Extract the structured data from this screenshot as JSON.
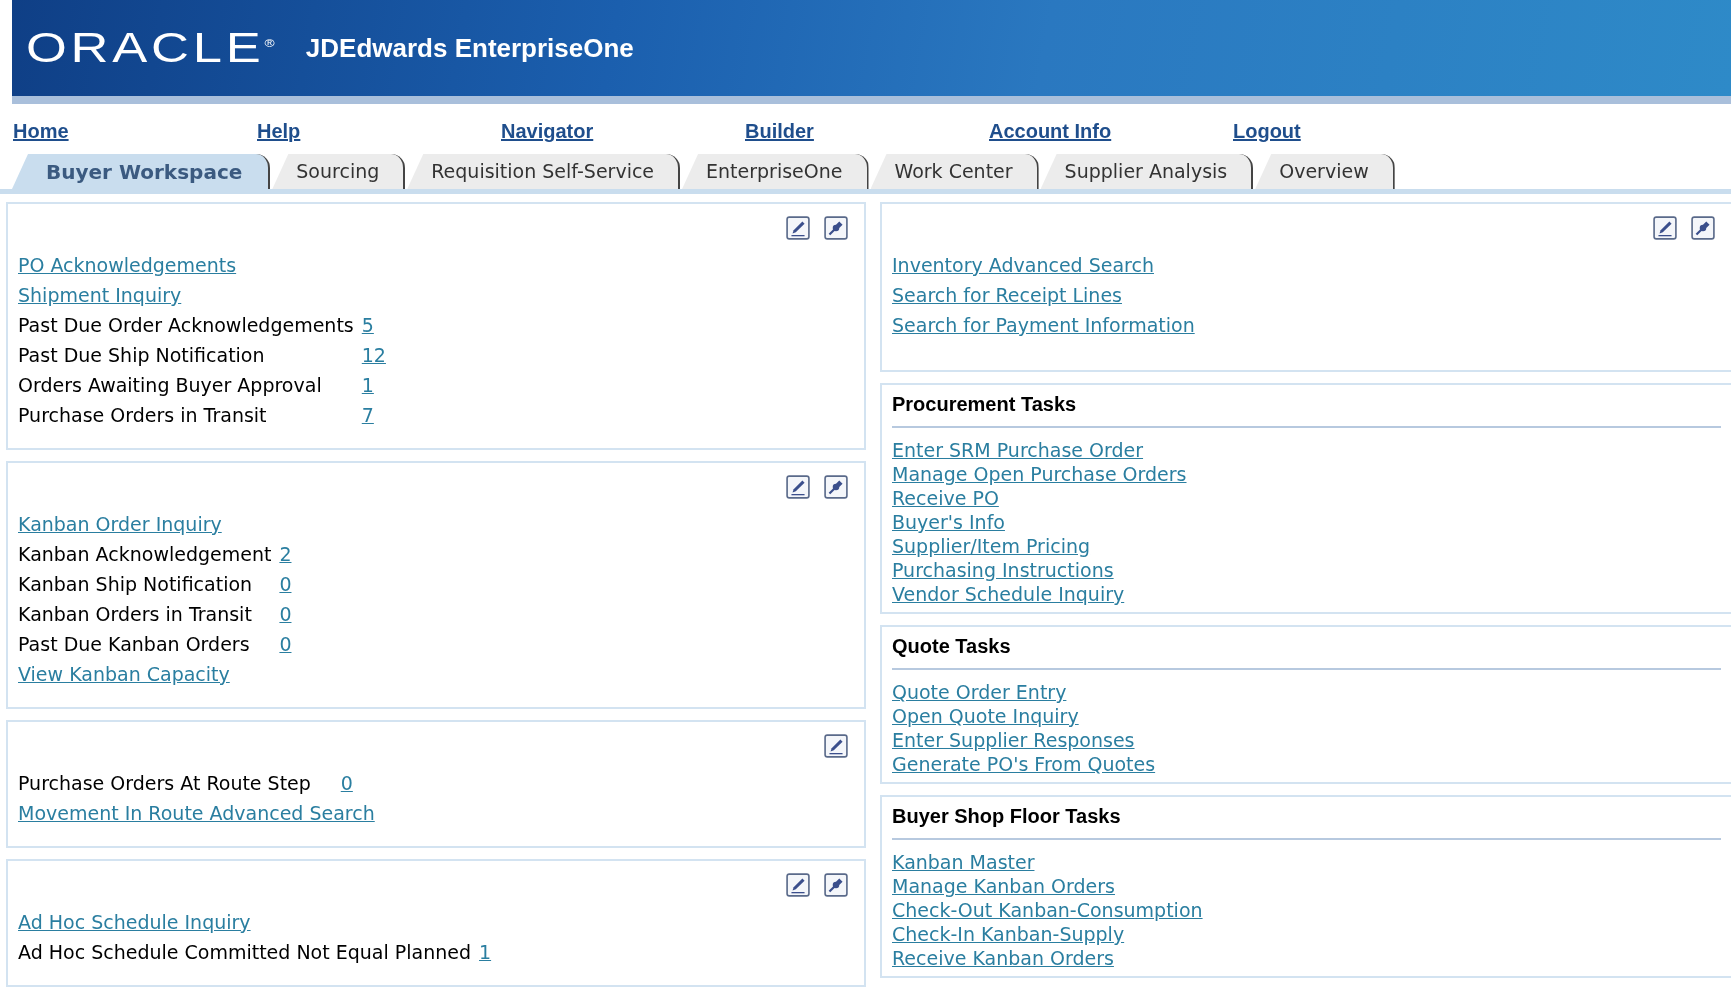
{
  "header": {
    "logo": "ORACLE$^{®}$",
    "product": "JDEdwards EnterpriseOne"
  },
  "nav_links": [
    "Home",
    "Help",
    "Navigator",
    "Builder",
    "Account Info",
    "Logout"
  ],
  "tabs": [
    {
      "label": "Buyer Workspace",
      "selected": true
    },
    {
      "label": "Sourcing",
      "selected": false
    },
    {
      "label": "Requisition Self-Service",
      "selected": false
    },
    {
      "label": "EnterpriseOne",
      "selected": false
    },
    {
      "label": "Work Center",
      "selected": false
    },
    {
      "label": "Supplier Analysis",
      "selected": false
    },
    {
      "label": "Overview",
      "selected": false
    }
  ],
  "left_panels": [
    {
      "tools": [
        {
          "kind": "edit"
        },
        {
          "kind": "configure"
        }
      ],
      "rows": [
        {
          "kind": "link",
          "text": "PO Acknowledgements"
        },
        {
          "kind": "link",
          "text": "Shipment Inquiry"
        },
        {
          "kind": "count",
          "text": "Past Due Order Acknowledgements",
          "count": "5"
        },
        {
          "kind": "count",
          "text": "Past Due Ship Notification",
          "count": "12"
        },
        {
          "kind": "count",
          "text": "Orders Awaiting Buyer Approval",
          "count": "1"
        },
        {
          "kind": "count",
          "text": "Purchase Orders in Transit",
          "count": "7"
        }
      ]
    },
    {
      "tools": [
        {
          "kind": "edit"
        },
        {
          "kind": "configure"
        }
      ],
      "rows": [
        {
          "kind": "link",
          "text": "Kanban Order Inquiry"
        },
        {
          "kind": "count",
          "text": "Kanban Acknowledgement",
          "count": "2"
        },
        {
          "kind": "count",
          "text": "Kanban Ship Notification",
          "count": "0"
        },
        {
          "kind": "count",
          "text": "Kanban Orders in Transit",
          "count": "0"
        },
        {
          "kind": "count",
          "text": "Past Due Kanban Orders",
          "count": "0"
        },
        {
          "kind": "link",
          "text": "View Kanban Capacity"
        }
      ]
    },
    {
      "tools": [
        {
          "kind": "edit"
        }
      ],
      "rows": [
        {
          "kind": "count",
          "text": "Purchase Orders At Route Step",
          "count": "0"
        },
        {
          "kind": "link",
          "text": "Movement In Route Advanced Search"
        }
      ]
    },
    {
      "tools": [
        {
          "kind": "edit"
        },
        {
          "kind": "configure"
        }
      ],
      "rows": [
        {
          "kind": "link",
          "text": "Ad Hoc Schedule Inquiry"
        },
        {
          "kind": "count",
          "text": "Ad Hoc Schedule Committed Not Equal Planned",
          "count": "1"
        }
      ]
    }
  ],
  "search_panel": {
    "tools": [
      {
        "kind": "edit"
      },
      {
        "kind": "configure"
      }
    ],
    "links": [
      "Inventory Advanced Search",
      "Search for Receipt Lines",
      "Search for Payment Information"
    ]
  },
  "task_panels": [
    {
      "title": "Procurement Tasks",
      "links": [
        "Enter SRM Purchase Order",
        "Manage Open Purchase Orders",
        "Receive PO",
        "Buyer's Info",
        "Supplier/Item Pricing",
        "Purchasing Instructions",
        "Vendor Schedule Inquiry"
      ]
    },
    {
      "title": "Quote Tasks",
      "links": [
        "Quote Order Entry",
        "Open Quote Inquiry",
        "Enter Supplier Responses",
        "Generate PO's From Quotes"
      ]
    },
    {
      "title": "Buyer Shop Floor Tasks",
      "links": [
        "Kanban Master",
        "Manage Kanban Orders",
        "Check-Out Kanban-Consumption",
        "Check-In Kanban-Supply",
        "Receive Kanban Orders"
      ]
    }
  ]
}
